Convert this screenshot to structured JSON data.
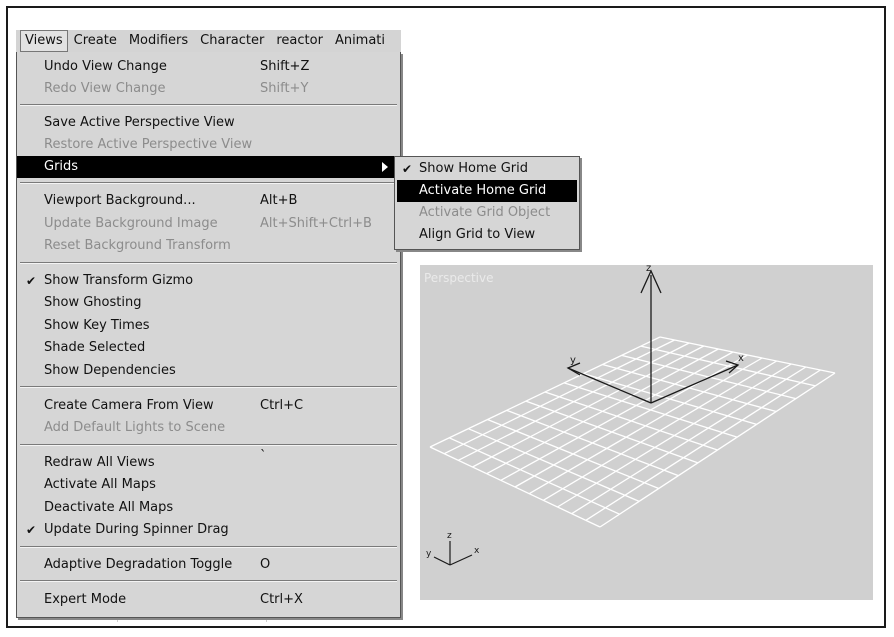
{
  "menubar": {
    "items": [
      "Views",
      "Create",
      "Modifiers",
      "Character",
      "reactor",
      "Animati"
    ]
  },
  "views_menu": {
    "items": [
      {
        "label": "Undo View Change",
        "shortcut": "Shift+Z"
      },
      {
        "label": "Redo View Change",
        "shortcut": "Shift+Y"
      },
      {
        "label": "Save Active Perspective View",
        "shortcut": ""
      },
      {
        "label": "Restore Active Perspective View",
        "shortcut": ""
      },
      {
        "label": "Grids",
        "shortcut": ""
      },
      {
        "label": "Viewport Background...",
        "shortcut": "Alt+B"
      },
      {
        "label": "Update Background Image",
        "shortcut": "Alt+Shift+Ctrl+B"
      },
      {
        "label": "Reset Background Transform",
        "shortcut": ""
      },
      {
        "label": "Show Transform Gizmo",
        "shortcut": "",
        "check": "✔"
      },
      {
        "label": "Show Ghosting",
        "shortcut": ""
      },
      {
        "label": "Show Key Times",
        "shortcut": ""
      },
      {
        "label": "Shade Selected",
        "shortcut": ""
      },
      {
        "label": "Show Dependencies",
        "shortcut": ""
      },
      {
        "label": "Create Camera From View",
        "shortcut": "Ctrl+C"
      },
      {
        "label": "Add Default Lights to Scene",
        "shortcut": ""
      },
      {
        "label": "Redraw All Views",
        "shortcut": "`"
      },
      {
        "label": "Activate All Maps",
        "shortcut": ""
      },
      {
        "label": "Deactivate All Maps",
        "shortcut": ""
      },
      {
        "label": "Update During Spinner Drag",
        "shortcut": "",
        "check": "✔"
      },
      {
        "label": "Adaptive Degradation Toggle",
        "shortcut": "O"
      },
      {
        "label": "Expert Mode",
        "shortcut": "Ctrl+X"
      }
    ]
  },
  "grids_submenu": {
    "items": [
      {
        "label": "Show Home Grid",
        "check": "✔"
      },
      {
        "label": "Activate Home Grid"
      },
      {
        "label": "Activate Grid Object"
      },
      {
        "label": "Align Grid to View"
      }
    ]
  },
  "viewport": {
    "label": "Perspective",
    "axis_labels": {
      "x": "x",
      "y": "y",
      "z": "z"
    }
  },
  "colors": {
    "menu_bg": "#d6d6d6",
    "highlight": "#000000",
    "disabled_text": "#8c8c8c",
    "viewport_bg": "#d0d0d0"
  }
}
